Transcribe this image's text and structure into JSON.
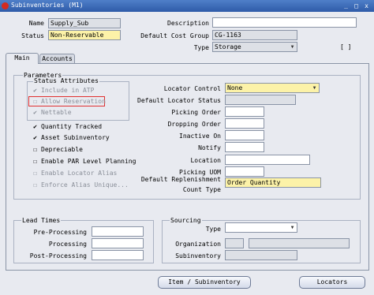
{
  "window": {
    "title": "Subinventories (M1)",
    "controls": [
      "_",
      "□",
      "x"
    ]
  },
  "header": {
    "name_label": "Name",
    "name_value": "Supply_Sub",
    "status_label": "Status",
    "status_value": "Non-Reservable",
    "description_label": "Description",
    "description_value": "",
    "cost_group_label": "Default Cost Group",
    "cost_group_value": "CG-1163",
    "type_label": "Type",
    "type_value": "Storage",
    "flex_field": "[ ]"
  },
  "tabs": [
    {
      "label": "Main"
    },
    {
      "label": "Accounts"
    }
  ],
  "parameters": {
    "caption": "Parameters",
    "status_attributes_caption": "Status Attributes",
    "include_atp": "Include in ATP",
    "allow_reservation": "Allow Reservation",
    "nettable": "Nettable",
    "quantity_tracked": "Quantity Tracked",
    "asset_subinventory": "Asset Subinventory",
    "depreciable": "Depreciable",
    "enable_par": "Enable PAR Level Planning",
    "enable_locator_alias": "Enable Locator Alias",
    "enforce_alias": "Enforce Alias Unique..."
  },
  "right_fields": {
    "locator_control_label": "Locator Control",
    "locator_control_value": "None",
    "default_locator_status_label": "Default Locator Status",
    "picking_order_label": "Picking Order",
    "dropping_order_label": "Dropping Order",
    "inactive_on_label": "Inactive On",
    "notify_label": "Notify",
    "location_label": "Location",
    "picking_uom_label": "Picking UOM",
    "default_replenishment_label_1": "Default Replenishment",
    "default_replenishment_label_2": "Count Type",
    "default_replenishment_value": "Order Quantity"
  },
  "lead_times": {
    "caption": "Lead Times",
    "pre_processing": "Pre-Processing",
    "processing": "Processing",
    "post_processing": "Post-Processing"
  },
  "sourcing": {
    "caption": "Sourcing",
    "type": "Type",
    "organization": "Organization",
    "subinventory": "Subinventory"
  },
  "buttons": {
    "item_subinventory": "Item / Subinventory",
    "locators": "Locators"
  }
}
